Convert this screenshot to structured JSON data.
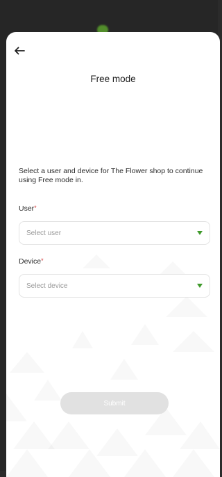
{
  "screen": {
    "title": "Free mode",
    "description": "Select a user and device for The Flower shop to continue using Free mode in."
  },
  "form": {
    "user_label": "User",
    "user_required": "*",
    "user_placeholder": "Select user",
    "device_label": "Device",
    "device_required": "*",
    "device_placeholder": "Select device",
    "submit_label": "Submit"
  },
  "icons": {
    "back": "arrow-left-icon",
    "dropdown": "caret-down-icon"
  },
  "colors": {
    "accent": "#3f9a2b",
    "required": "#d23a3a",
    "submit_disabled": "#e1e1e1"
  }
}
